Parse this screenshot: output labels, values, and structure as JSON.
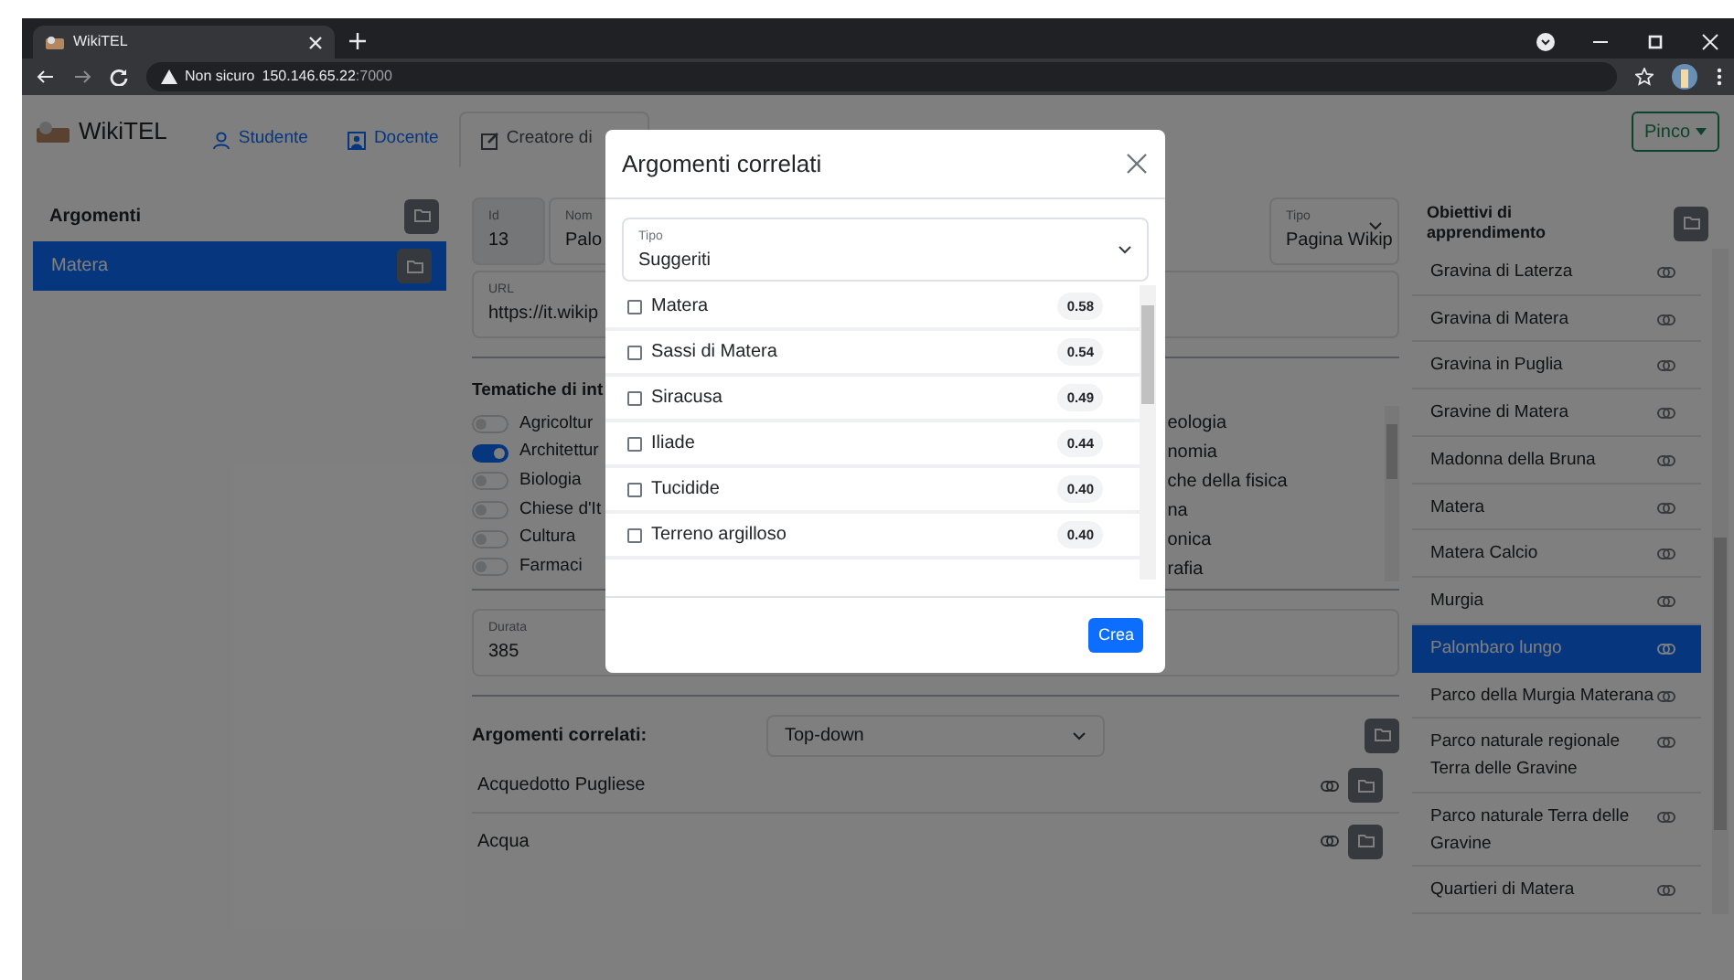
{
  "browser": {
    "tab_title": "WikiTEL",
    "security": "Non sicuro",
    "host": "150.146.65.22",
    "port": ":7000"
  },
  "navbar": {
    "brand": "WikiTEL",
    "tabs": [
      {
        "label": "Studente",
        "selected": false
      },
      {
        "label": "Docente",
        "selected": false
      },
      {
        "label": "Creatore di",
        "selected": true
      }
    ],
    "user_menu": "Pinco"
  },
  "sidebar": {
    "title": "Argomenti",
    "items": [
      {
        "label": "Matera",
        "selected": true
      }
    ]
  },
  "details": {
    "id": {
      "label": "Id",
      "value": "13"
    },
    "name": {
      "label": "Nom",
      "value": "Palo"
    },
    "type": {
      "label": "Tipo",
      "value": "Pagina Wikip"
    },
    "url": {
      "label": "URL",
      "value": "https://it.wikip"
    },
    "topics_title": "Tematiche di int",
    "topics": [
      {
        "label": "Agricoltur",
        "on": false
      },
      {
        "label": "Architettur",
        "on": true
      },
      {
        "label": "Biologia",
        "on": false
      },
      {
        "label": "Chiese d'It",
        "on": false
      },
      {
        "label": "Cultura",
        "on": false
      },
      {
        "label": "Farmaci",
        "on": false
      }
    ],
    "topics_right": [
      "eologia",
      "nomia",
      "che della fisica",
      "na",
      "onica",
      "rafia"
    ],
    "duration": {
      "label": "Durata",
      "value": "385"
    }
  },
  "related": {
    "title": "Argomenti correlati:",
    "mode": "Top-down",
    "items": [
      "Acquedotto Pugliese",
      "Acqua"
    ]
  },
  "objectives": {
    "title": "Obiettivi di apprendimento",
    "items": [
      {
        "label": "Gravina di Laterza",
        "selected": false
      },
      {
        "label": "Gravina di Matera",
        "selected": false
      },
      {
        "label": "Gravina in Puglia",
        "selected": false
      },
      {
        "label": "Gravine di Matera",
        "selected": false
      },
      {
        "label": "Madonna della Bruna",
        "selected": false
      },
      {
        "label": "Matera",
        "selected": false
      },
      {
        "label": "Matera Calcio",
        "selected": false
      },
      {
        "label": "Murgia",
        "selected": false
      },
      {
        "label": "Palombaro lungo",
        "selected": true
      },
      {
        "label": "Parco della Murgia Materana",
        "selected": false
      },
      {
        "label": "Parco naturale regionale Terra delle Gravine",
        "selected": false
      },
      {
        "label": "Parco naturale Terra delle Gravine",
        "selected": false
      },
      {
        "label": "Quartieri di Matera",
        "selected": false
      }
    ]
  },
  "modal": {
    "title": "Argomenti correlati",
    "select": {
      "label": "Tipo",
      "value": "Suggeriti"
    },
    "items": [
      {
        "label": "Matera",
        "score": "0.58",
        "checked": false
      },
      {
        "label": "Sassi di Matera",
        "score": "0.54",
        "checked": false
      },
      {
        "label": "Siracusa",
        "score": "0.49",
        "checked": false
      },
      {
        "label": "Iliade",
        "score": "0.44",
        "checked": false
      },
      {
        "label": "Tucidide",
        "score": "0.40",
        "checked": false
      },
      {
        "label": "Terreno argilloso",
        "score": "0.40",
        "checked": false
      }
    ],
    "button": "Crea"
  }
}
